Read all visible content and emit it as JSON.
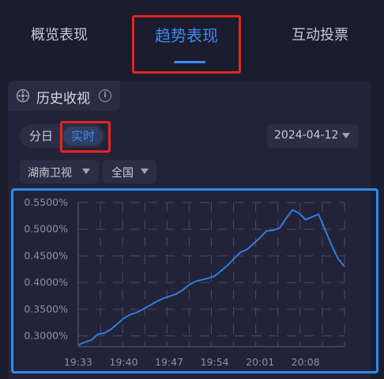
{
  "tabs": [
    {
      "label": "概览表现",
      "active": false
    },
    {
      "label": "趋势表现",
      "active": true
    },
    {
      "label": "互动投票",
      "active": false
    }
  ],
  "section": {
    "title": "历史收视",
    "icon": "broadcast-icon",
    "info_icon": "info-icon"
  },
  "mode_toggle": {
    "options": [
      "分日",
      "实时"
    ],
    "selected": "实时"
  },
  "date_select": {
    "value": "2024-04-12"
  },
  "channel_select": {
    "value": "湖南卫视"
  },
  "region_select": {
    "value": "全国"
  },
  "colors": {
    "accent": "#3d8bf0",
    "highlight": "#e2261f",
    "chart_frame": "#2b8cf0",
    "line": "#2f7de0"
  },
  "chart_data": {
    "type": "line",
    "x": [
      "19:33",
      "19:34",
      "19:35",
      "19:36",
      "19:37",
      "19:38",
      "19:39",
      "19:40",
      "19:41",
      "19:42",
      "19:43",
      "19:44",
      "19:45",
      "19:46",
      "19:47",
      "19:48",
      "19:49",
      "19:50",
      "19:51",
      "19:52",
      "19:53",
      "19:54",
      "19:55",
      "19:56",
      "19:57",
      "19:58",
      "19:59",
      "20:00",
      "20:01",
      "20:02",
      "20:03",
      "20:04",
      "20:05",
      "20:06",
      "20:07",
      "20:08",
      "20:09",
      "20:10",
      "20:11",
      "20:12",
      "20:13",
      "20:14"
    ],
    "xticks": [
      "19:33",
      "19:40",
      "19:47",
      "19:54",
      "20:01",
      "20:08"
    ],
    "yticks": [
      "0.3000%",
      "0.3500%",
      "0.4000%",
      "0.4500%",
      "0.5000%",
      "0.5500%"
    ],
    "ylim": [
      0.0028,
      0.0055
    ],
    "series": [
      {
        "values": [
          0.00283,
          0.00288,
          0.00292,
          0.00303,
          0.00305,
          0.00312,
          0.00322,
          0.00333,
          0.0034,
          0.00344,
          0.0035,
          0.00357,
          0.00364,
          0.0037,
          0.00374,
          0.00378,
          0.00385,
          0.00395,
          0.00402,
          0.00405,
          0.00408,
          0.00412,
          0.00422,
          0.00432,
          0.00445,
          0.00457,
          0.00462,
          0.00473,
          0.00484,
          0.00497,
          0.00498,
          0.00502,
          0.0052,
          0.00536,
          0.0053,
          0.00518,
          0.00523,
          0.00528,
          0.005,
          0.0047,
          0.00445,
          0.0043
        ]
      }
    ],
    "grid": true
  }
}
